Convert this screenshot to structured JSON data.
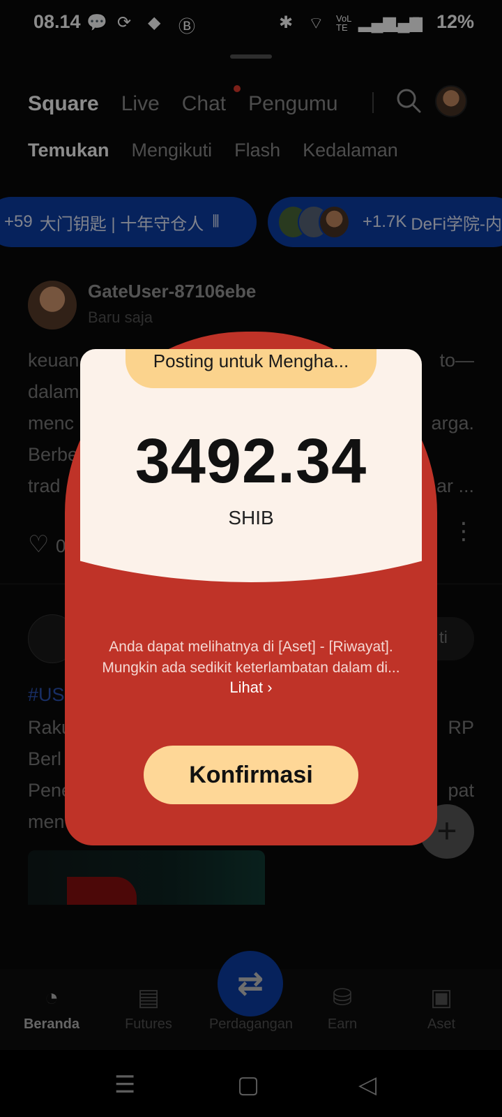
{
  "status_bar": {
    "time": "08.14",
    "battery": "12%"
  },
  "top_tabs": [
    "Square",
    "Live",
    "Chat",
    "Pengumu"
  ],
  "sub_tabs": [
    "Temukan",
    "Mengikuti",
    "Flash",
    "Kedalaman"
  ],
  "chat_rooms": [
    {
      "count": "+59",
      "name": "大门钥匙 | 十年守仓人"
    },
    {
      "count": "+1.7K",
      "name": "DeFi学院-内幕"
    }
  ],
  "post1": {
    "username": "GateUser-87106ebe",
    "time": "Baru saja",
    "lines": [
      "keuan",
      "dalam",
      "menc",
      "Berbe",
      "trad"
    ],
    "lines_right": [
      "to—",
      "",
      "arga.",
      "",
      "ar ..."
    ],
    "likes": "0"
  },
  "post2": {
    "follow_label": "ti",
    "tag": "#US",
    "lines": [
      "Raku",
      "Berl",
      "Pene",
      "men"
    ],
    "lines_right": [
      "RP",
      "",
      "pat",
      ""
    ]
  },
  "modal": {
    "title": "Posting untuk Mengha...",
    "amount": "3492.34",
    "currency": "SHIB",
    "note_line1": "Anda dapat melihatnya di [Aset] - [Riwayat].",
    "note_line2": "Mungkin ada sedikit keterlambatan dalam di...",
    "link": "Lihat",
    "confirm": "Konfirmasi"
  },
  "bottom_nav": [
    "Beranda",
    "Futures",
    "Perdagangan",
    "Earn",
    "Aset"
  ],
  "colors": {
    "accent_blue": "#0b3ea8",
    "modal_red": "#bf3328",
    "confirm_yellow": "#fed797"
  }
}
